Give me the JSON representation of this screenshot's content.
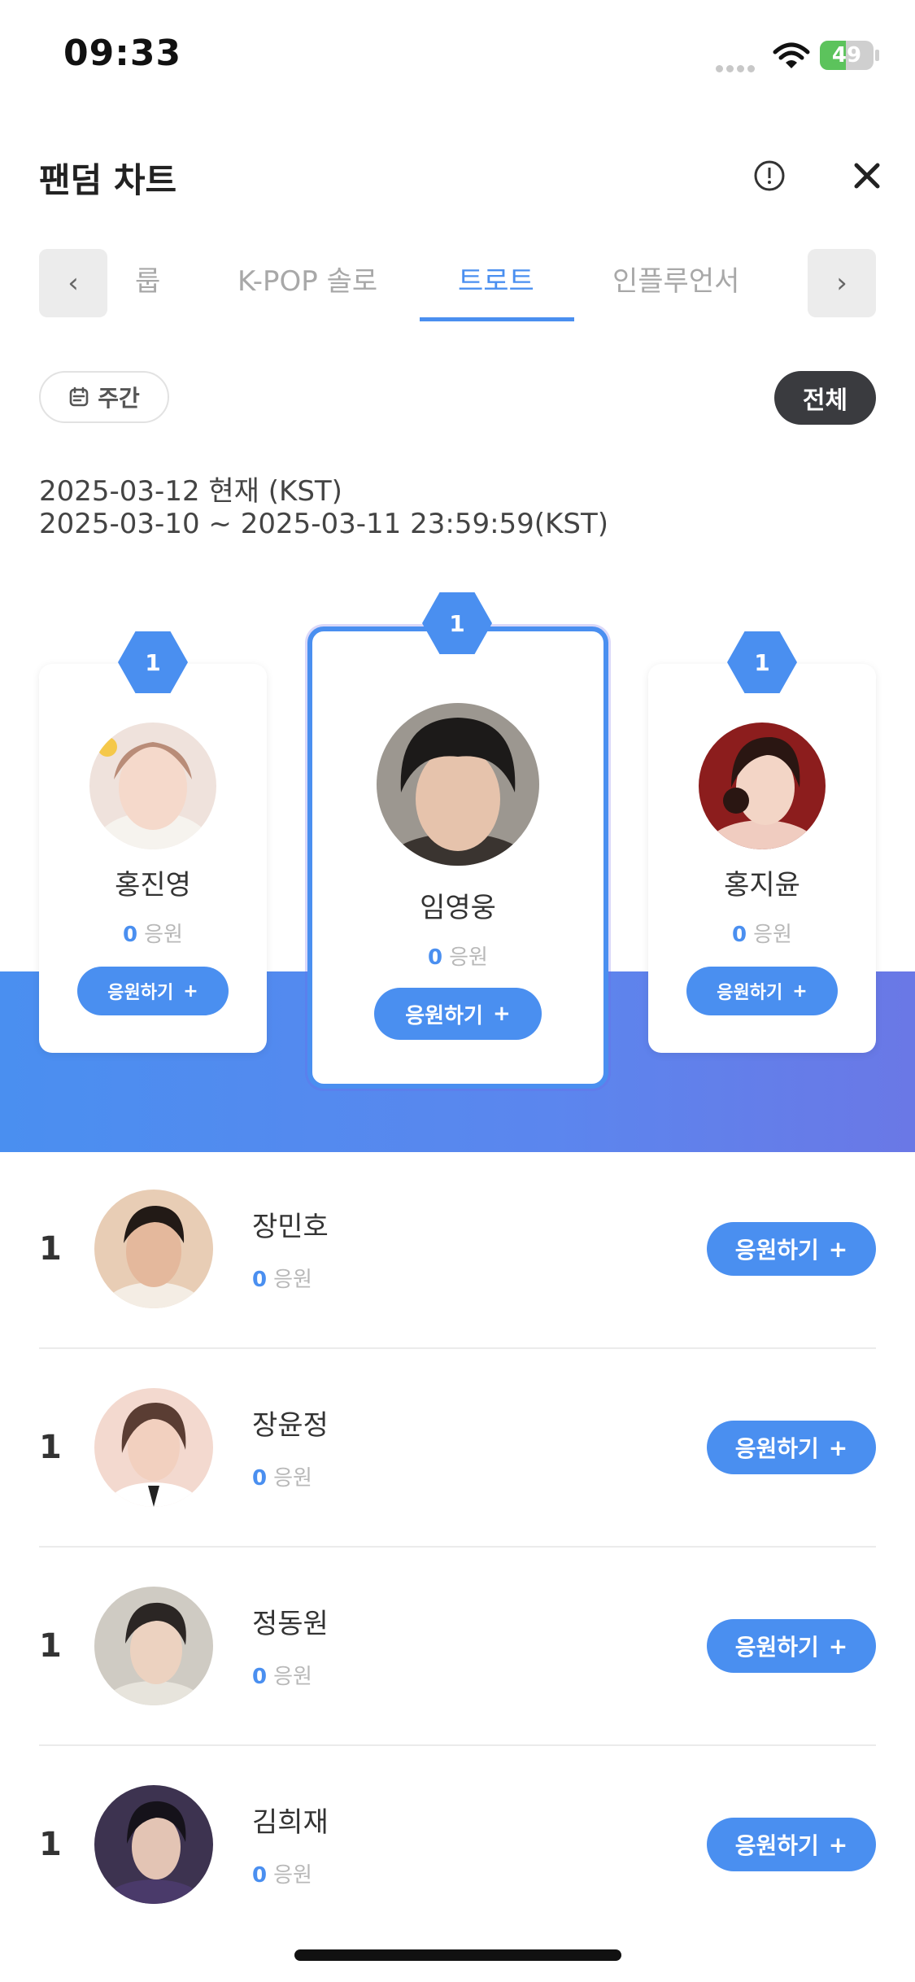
{
  "status_bar": {
    "time": "09:33",
    "battery": "49"
  },
  "header": {
    "title": "팬덤 차트"
  },
  "tabs": {
    "prev": "‹",
    "next": "›",
    "items": [
      {
        "label": "룹"
      },
      {
        "label": "K-POP 솔로"
      },
      {
        "label": "트로트"
      },
      {
        "label": "인플루언서"
      }
    ],
    "active_index": 2
  },
  "filters": {
    "period": "주간",
    "all": "전체"
  },
  "dates": {
    "current": "2025-03-12 현재 (KST)",
    "range": "2025-03-10 ~ 2025-03-11 23:59:59(KST)"
  },
  "labels": {
    "votes_unit": "응원",
    "cheer": "응원하기",
    "plus": "+"
  },
  "podium": [
    {
      "rank": "1",
      "name": "홍진영",
      "votes": "0",
      "avatar_color": "#e9d6d0"
    },
    {
      "rank": "1",
      "name": "임영웅",
      "votes": "0",
      "avatar_color": "#2b2624"
    },
    {
      "rank": "1",
      "name": "홍지윤",
      "votes": "0",
      "avatar_color": "#8c1d1d"
    }
  ],
  "ranking": [
    {
      "rank": "1",
      "name": "장민호",
      "votes": "0",
      "avatar_color": "#d8b79a"
    },
    {
      "rank": "1",
      "name": "장윤정",
      "votes": "0",
      "avatar_color": "#efd2c8"
    },
    {
      "rank": "1",
      "name": "정동원",
      "votes": "0",
      "avatar_color": "#c9c6bf"
    },
    {
      "rank": "1",
      "name": "김희재",
      "votes": "0",
      "avatar_color": "#3d3350"
    }
  ],
  "colors": {
    "accent": "#4a8ff0",
    "dark_button": "#3a3b3f",
    "inactive_tab": "#a8a8a8"
  }
}
